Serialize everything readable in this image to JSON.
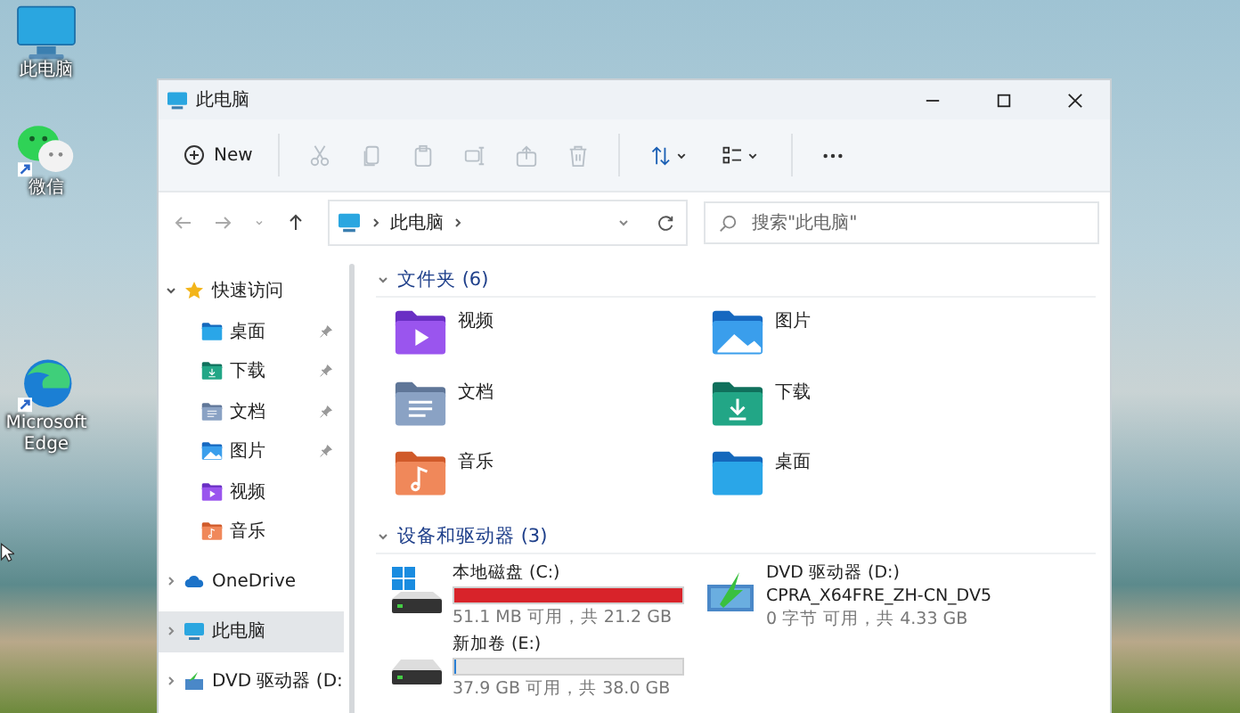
{
  "desktop_icons": [
    {
      "label": "此电脑",
      "kind": "pc"
    },
    {
      "label": "微信",
      "kind": "chat"
    },
    {
      "label": "Microsoft Edge",
      "kind": "browser"
    }
  ],
  "window": {
    "title": "此电脑"
  },
  "toolbar": {
    "new_label": "New",
    "actions": [
      {
        "kind": "cut",
        "disabled": true
      },
      {
        "kind": "copy",
        "disabled": true
      },
      {
        "kind": "paste",
        "disabled": true
      },
      {
        "kind": "rename",
        "disabled": true
      },
      {
        "kind": "share",
        "disabled": true
      },
      {
        "kind": "delete",
        "disabled": true
      },
      {
        "kind": "sort",
        "disabled": false
      },
      {
        "kind": "view",
        "disabled": false
      },
      {
        "kind": "more",
        "disabled": false
      }
    ]
  },
  "address": {
    "path": [
      "此电脑"
    ]
  },
  "search": {
    "placeholder": "搜索\"此电脑\""
  },
  "sidebar": {
    "items": [
      {
        "label": "快速访问",
        "kind": "quick",
        "expanded": true,
        "selected": false,
        "children": [
          {
            "label": "桌面",
            "kind": "desktop",
            "pinned": true,
            "selected": false
          },
          {
            "label": "下载",
            "kind": "downloads",
            "pinned": true,
            "selected": false
          },
          {
            "label": "文档",
            "kind": "documents",
            "pinned": true,
            "selected": false
          },
          {
            "label": "图片",
            "kind": "pictures",
            "pinned": true,
            "selected": false
          },
          {
            "label": "视频",
            "kind": "videos",
            "pinned": false,
            "selected": false
          },
          {
            "label": "音乐",
            "kind": "music",
            "pinned": false,
            "selected": false
          }
        ]
      },
      {
        "label": "OneDrive",
        "kind": "cloud",
        "expanded": false,
        "selected": false
      },
      {
        "label": "此电脑",
        "kind": "pc",
        "expanded": false,
        "selected": true
      },
      {
        "label": "DVD 驱动器 (D:",
        "kind": "dvd",
        "expanded": false,
        "selected": false
      }
    ]
  },
  "folders": {
    "title": "文件夹 (6)",
    "expanded": true,
    "items": [
      {
        "name": "视频",
        "kind": "videos"
      },
      {
        "name": "图片",
        "kind": "pictures"
      },
      {
        "name": "文档",
        "kind": "documents"
      },
      {
        "name": "下载",
        "kind": "downloads"
      },
      {
        "name": "音乐",
        "kind": "music"
      },
      {
        "name": "桌面",
        "kind": "desktop"
      }
    ]
  },
  "drives": {
    "title": "设备和驱动器 (3)",
    "expanded": true,
    "items": [
      {
        "name": "本地磁盘 (C:)",
        "kind": "system",
        "level": 0.998,
        "detail": "51.1 MB 可用，共 21.2 GB"
      },
      {
        "name": "DVD 驱动器 (D:)",
        "kind": "dvd",
        "volume": "CPRA_X64FRE_ZH-CN_DV5",
        "detail": "0 字节 可用，共 4.33 GB"
      },
      {
        "name": "新加卷 (E:)",
        "kind": "disk",
        "level": 0.003,
        "detail": "37.9 GB 可用，共 38.0 GB"
      }
    ]
  }
}
